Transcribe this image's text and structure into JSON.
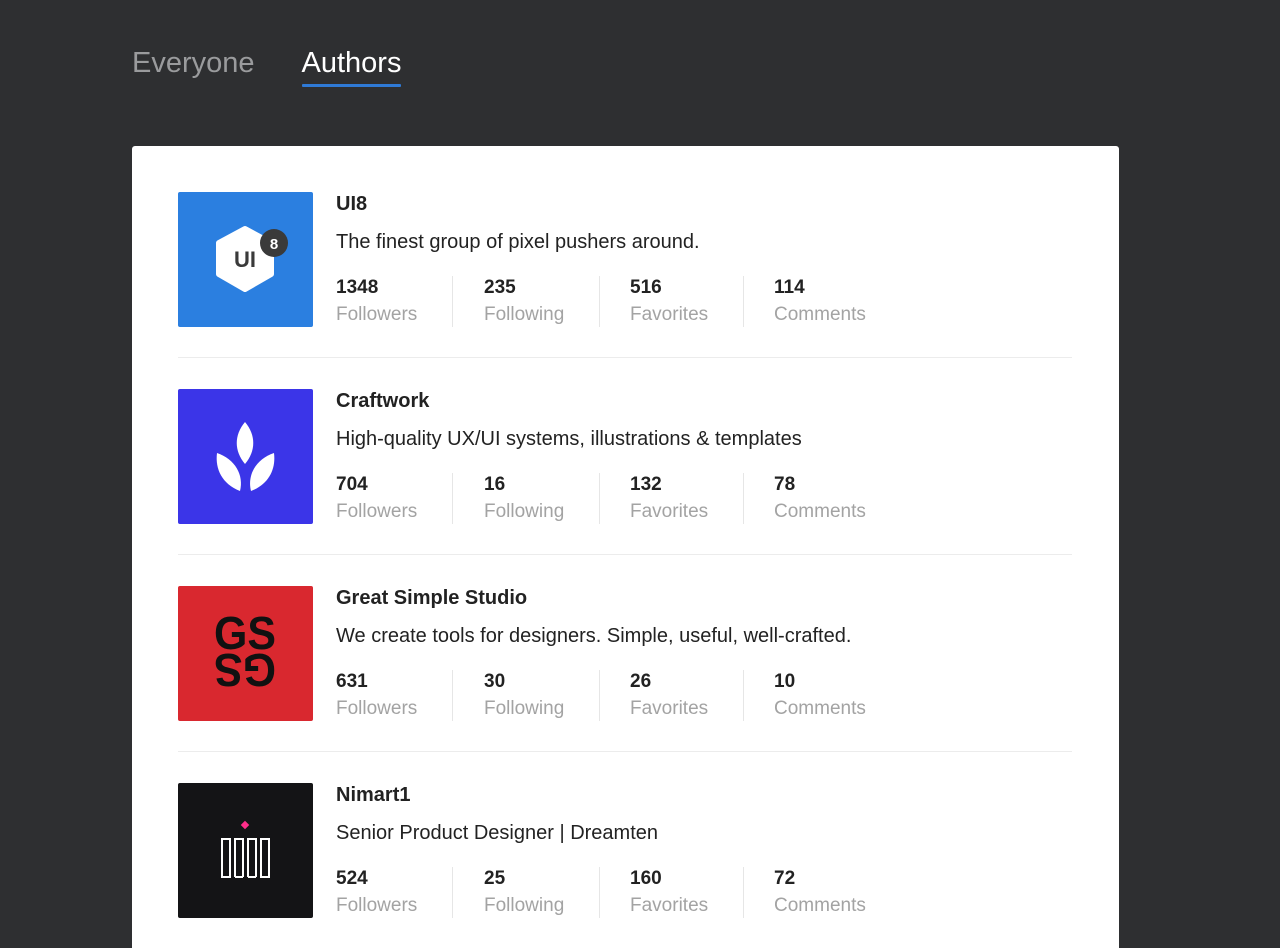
{
  "tabs": [
    {
      "label": "Everyone",
      "active": false
    },
    {
      "label": "Authors",
      "active": true
    }
  ],
  "colors": {
    "background": "#2e2f31",
    "accent": "#2f7ad6",
    "ui8_bg": "#2b7fe0",
    "craftwork_bg": "#3b35e8",
    "gss_bg": "#d9282f",
    "nimart_bg": "#141416",
    "nimart_accent": "#ff2d8a"
  },
  "authors": [
    {
      "name": "UI8",
      "description": "The finest group of pixel pushers around.",
      "avatar_icon": "ui8-logo-icon",
      "logo_text": "UI",
      "logo_badge": "8",
      "stats": [
        {
          "value": "1348",
          "label": "Followers"
        },
        {
          "value": "235",
          "label": "Following"
        },
        {
          "value": "516",
          "label": "Favorites"
        },
        {
          "value": "114",
          "label": "Comments"
        }
      ]
    },
    {
      "name": "Craftwork",
      "description": "High-quality UX/UI systems, illustrations & templates",
      "avatar_icon": "craftwork-leaf-icon",
      "stats": [
        {
          "value": "704",
          "label": "Followers"
        },
        {
          "value": "16",
          "label": "Following"
        },
        {
          "value": "132",
          "label": "Favorites"
        },
        {
          "value": "78",
          "label": "Comments"
        }
      ]
    },
    {
      "name": "Great Simple Studio",
      "description": "We create tools for designers. Simple, useful, well-crafted.",
      "avatar_icon": "gss-logo-icon",
      "logo_text": "GS",
      "stats": [
        {
          "value": "631",
          "label": "Followers"
        },
        {
          "value": "30",
          "label": "Following"
        },
        {
          "value": "26",
          "label": "Favorites"
        },
        {
          "value": "10",
          "label": "Comments"
        }
      ]
    },
    {
      "name": "Nimart1",
      "description": "Senior Product Designer | Dreamten",
      "avatar_icon": "nimart-logo-icon",
      "stats": [
        {
          "value": "524",
          "label": "Followers"
        },
        {
          "value": "25",
          "label": "Following"
        },
        {
          "value": "160",
          "label": "Favorites"
        },
        {
          "value": "72",
          "label": "Comments"
        }
      ]
    }
  ]
}
